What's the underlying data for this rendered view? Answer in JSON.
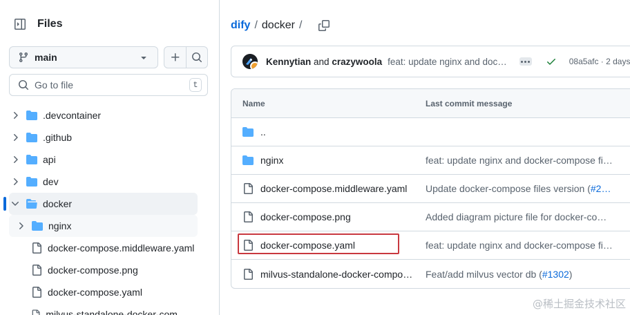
{
  "sidebar": {
    "title": "Files",
    "branch": "main",
    "goto_placeholder": "Go to file",
    "goto_shortcut": "t",
    "tree": [
      {
        "label": ".devcontainer",
        "type": "folder"
      },
      {
        "label": ".github",
        "type": "folder"
      },
      {
        "label": "api",
        "type": "folder"
      },
      {
        "label": "dev",
        "type": "folder"
      },
      {
        "label": "docker",
        "type": "folder"
      },
      {
        "label": "nginx",
        "type": "folder"
      },
      {
        "label": "docker-compose.middleware.yaml",
        "type": "file"
      },
      {
        "label": "docker-compose.png",
        "type": "file"
      },
      {
        "label": "docker-compose.yaml",
        "type": "file"
      },
      {
        "label": "milvus-standalone-docker-compose.yml",
        "type": "file"
      }
    ]
  },
  "breadcrumb": {
    "repo": "dify",
    "sep": "/",
    "folder": "docker",
    "trailing": "/"
  },
  "commit": {
    "author1": "Kennytian",
    "and": "and",
    "author2": "crazywoola",
    "message": "feat: update nginx and doc…",
    "meta": "08a5afc · 2 days"
  },
  "table": {
    "col_name": "Name",
    "col_msg": "Last commit message",
    "rows": [
      {
        "name": "..",
        "type": "folder",
        "msg": ""
      },
      {
        "name": "nginx",
        "type": "folder",
        "msg": "feat: update nginx and docker-compose fi…"
      },
      {
        "name": "docker-compose.middleware.yaml",
        "type": "file",
        "msg": "Update docker-compose files version (",
        "pr": "#2…"
      },
      {
        "name": "docker-compose.png",
        "type": "file",
        "msg": "Added diagram picture file for docker-co…"
      },
      {
        "name": "docker-compose.yaml",
        "type": "file",
        "msg": "feat: update nginx and docker-compose fi…"
      },
      {
        "name": "milvus-standalone-docker-compo…",
        "type": "file",
        "msg": "Feat/add milvus vector db (",
        "pr": "#1302",
        "msg_end": ")"
      }
    ]
  },
  "watermark": "@稀土掘金技术社区",
  "colors": {
    "accent": "#0969da",
    "folder": "#54aeff",
    "highlight": "#c8383f",
    "success": "#1a7f37"
  }
}
